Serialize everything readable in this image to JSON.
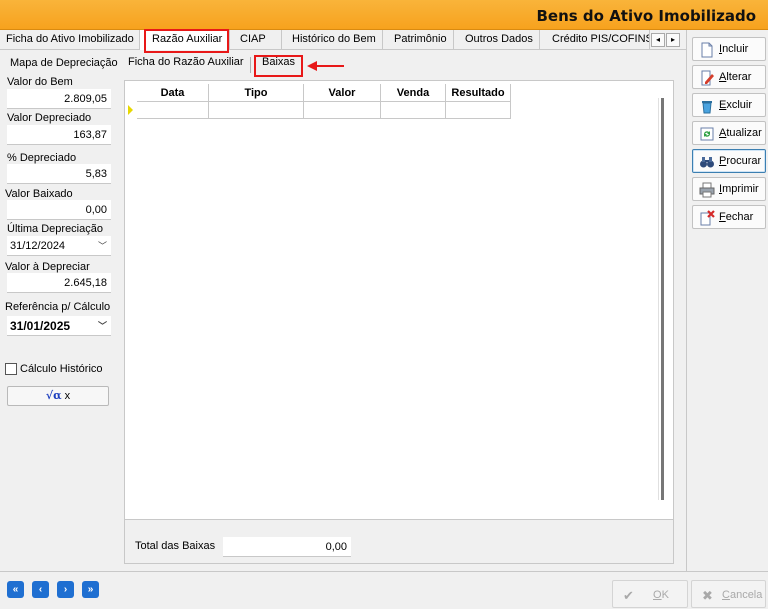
{
  "window": {
    "title": "Bens do Ativo Imobilizado"
  },
  "tabs": [
    {
      "label": "Ficha do Ativo Imobilizado"
    },
    {
      "label": "Razão Auxiliar"
    },
    {
      "label": "CIAP"
    },
    {
      "label": "Histórico do Bem"
    },
    {
      "label": "Patrimônio"
    },
    {
      "label": "Outros Dados"
    },
    {
      "label": "Crédito PIS/COFINS"
    }
  ],
  "tab_scroll": {
    "left": "◂",
    "right": "▸"
  },
  "left_panel": {
    "title": "Mapa de Depreciação",
    "valor_do_bem": {
      "label": "Valor do Bem",
      "value": "2.809,05"
    },
    "valor_depreciado": {
      "label": "Valor Depreciado",
      "value": "163,87"
    },
    "pct_depreciado": {
      "label": "% Depreciado",
      "value": "5,83"
    },
    "valor_baixado": {
      "label": "Valor Baixado",
      "value": "0,00"
    },
    "ultima_depreciacao": {
      "label": "Última Depreciação",
      "value": "31/12/2024"
    },
    "valor_a_depreciar": {
      "label": "Valor à Depreciar",
      "value": "2.645,18"
    },
    "referencia_calculo": {
      "label": "Referência p/ Cálculo",
      "value": "31/01/2025"
    },
    "calculo_historico": {
      "label": "Cálculo Histórico",
      "checked": false
    },
    "calc_button": {
      "symbol": "√α",
      "label": "x"
    }
  },
  "sub_tabs": [
    {
      "label": "Ficha do Razão Auxiliar"
    },
    {
      "label": "Baixas"
    }
  ],
  "grid": {
    "columns": [
      "Data",
      "Tipo",
      "Valor",
      "Venda",
      "Resultado"
    ],
    "rows": []
  },
  "totals": {
    "label": "Total das Baixas",
    "value": "0,00"
  },
  "actions": [
    {
      "first": "I",
      "rest": "ncluir",
      "icon": "document-icon"
    },
    {
      "first": "A",
      "rest": "lterar",
      "icon": "edit-icon"
    },
    {
      "first": "E",
      "rest": "xcluir",
      "icon": "delete-icon"
    },
    {
      "first": "A",
      "rest": "tualizar",
      "icon": "refresh-icon"
    },
    {
      "first": "P",
      "rest": "rocurar",
      "icon": "binoculars-icon"
    },
    {
      "first": "I",
      "rest": "mprimir",
      "icon": "printer-icon"
    },
    {
      "first": "F",
      "rest": "echar",
      "icon": "close-document-icon"
    }
  ],
  "nav": {
    "first": "«",
    "prev": "‹",
    "next": "›",
    "last": "»"
  },
  "bottom_buttons": {
    "ok": {
      "first": "O",
      "rest": "K",
      "icon": "✔"
    },
    "cancel": {
      "first": "C",
      "rest": "ancela",
      "icon": "✖"
    }
  },
  "colors": {
    "title_bar": "#f7a21e",
    "highlight": "#e81818",
    "nav": "#1f6fd1",
    "row_indicator": "#e7d800"
  }
}
